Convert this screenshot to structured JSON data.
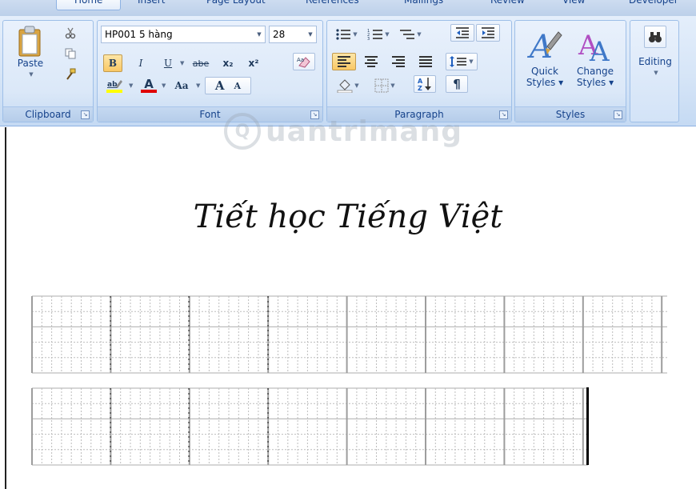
{
  "tabs": [
    "Home",
    "Insert",
    "Page Layout",
    "References",
    "Mailings",
    "Review",
    "View",
    "Developer"
  ],
  "clipboard": {
    "paste_label": "Paste",
    "group_label": "Clipboard",
    "cut_icon": "scissors-icon",
    "copy_icon": "copy-icon",
    "format_painter_icon": "paintbrush-icon"
  },
  "font": {
    "font_name": "HP001 5 hàng",
    "font_size": "28",
    "bold": "B",
    "italic": "I",
    "underline": "U",
    "strike": "abe",
    "subscript": "x₂",
    "superscript": "x²",
    "clear_format_label": "Aa",
    "highlight_label": "ab",
    "font_color_label": "A",
    "change_case": "Aa",
    "grow": "A",
    "shrink": "A",
    "group_label": "Font",
    "highlight_color": "#ffff00",
    "font_color": "#ff0000"
  },
  "paragraph": {
    "group_label": "Paragraph",
    "sort_label": "AZ",
    "pilcrow": "¶"
  },
  "styles": {
    "quick_styles": "Quick Styles",
    "change_styles": "Change Styles",
    "group_label": "Styles",
    "quick_line1": "Quick",
    "quick_line2": "Styles ▾",
    "change_line1": "Change",
    "change_line2": "Styles ▾"
  },
  "editing": {
    "label": "Editing",
    "icon": "binoculars-icon"
  },
  "document": {
    "heading": "Tiết học Tiếng Việt",
    "watermark": "uantrimang",
    "grid_color": "#bdbdbd",
    "ink_color": "#111111"
  }
}
